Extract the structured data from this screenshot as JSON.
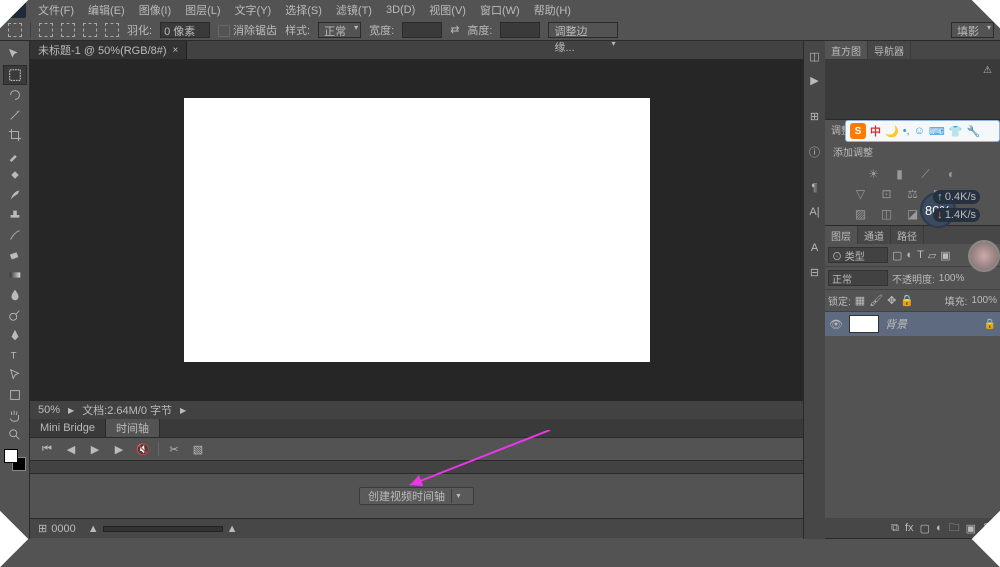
{
  "menu": [
    "文件(F)",
    "编辑(E)",
    "图像(I)",
    "图层(L)",
    "文字(Y)",
    "选择(S)",
    "滤镜(T)",
    "3D(D)",
    "视图(V)",
    "窗口(W)",
    "帮助(H)"
  ],
  "optbar": {
    "lbl_feather": "羽化:",
    "val_feather": "0 像素",
    "lbl_antialias": "消除锯齿",
    "lbl_style": "样式:",
    "val_style": "正常",
    "lbl_width": "宽度:",
    "lbl_height": "高度:",
    "lbl_adj": "调整边缘...",
    "btn_right": "填影"
  },
  "doc": {
    "tab": "未标题-1 @ 50%(RGB/8#)",
    "close": "×"
  },
  "status": {
    "zoom": "50%",
    "info": "文档:2.64M/0 字节"
  },
  "lowerTabs": {
    "miniBridge": "Mini Bridge",
    "timeline": "时间轴"
  },
  "timeline": {
    "button": "创建视频时间轴",
    "footlabel": "0000"
  },
  "panelHist": {
    "tab1": "直方图",
    "tab2": "导航器",
    "warn": "⚠"
  },
  "panelAdj": {
    "tab": "调整",
    "title": "添加调整"
  },
  "panelLayers": {
    "tab1": "图层",
    "tab2": "通道",
    "tab3": "路径",
    "kind": "⊙ 类型",
    "blend": "正常",
    "opacityLbl": "不透明度:",
    "opacityVal": "100%",
    "lockLbl": "锁定:",
    "fillLbl": "填充:",
    "fillVal": "100%",
    "layerName": "背景"
  },
  "ime": {
    "ch": "中",
    "badge": "80%",
    "spd1": "0.4K/s",
    "spd2": "1.4K/s"
  }
}
